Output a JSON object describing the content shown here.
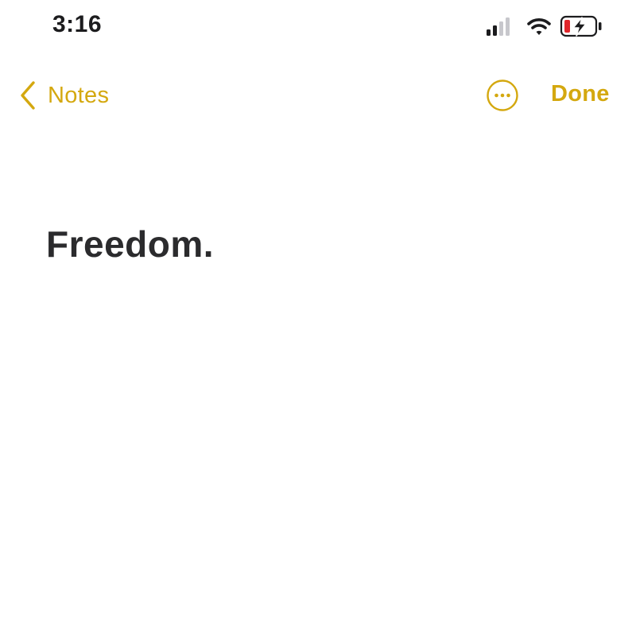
{
  "status_bar": {
    "time": "3:16",
    "signal_icon": "cellular-signal-icon",
    "wifi_icon": "wifi-icon",
    "battery_icon": "battery-charging-icon",
    "battery_level": 0.15
  },
  "nav": {
    "back_label": "Notes",
    "back_icon": "chevron-left-icon",
    "more_icon": "ellipsis-circle-icon",
    "done_label": "Done"
  },
  "note": {
    "title": "Freedom."
  },
  "colors": {
    "accent": "#d4a80f",
    "text": "#2b2b2d",
    "battery_low": "#e0262b",
    "background": "#ffffff"
  }
}
